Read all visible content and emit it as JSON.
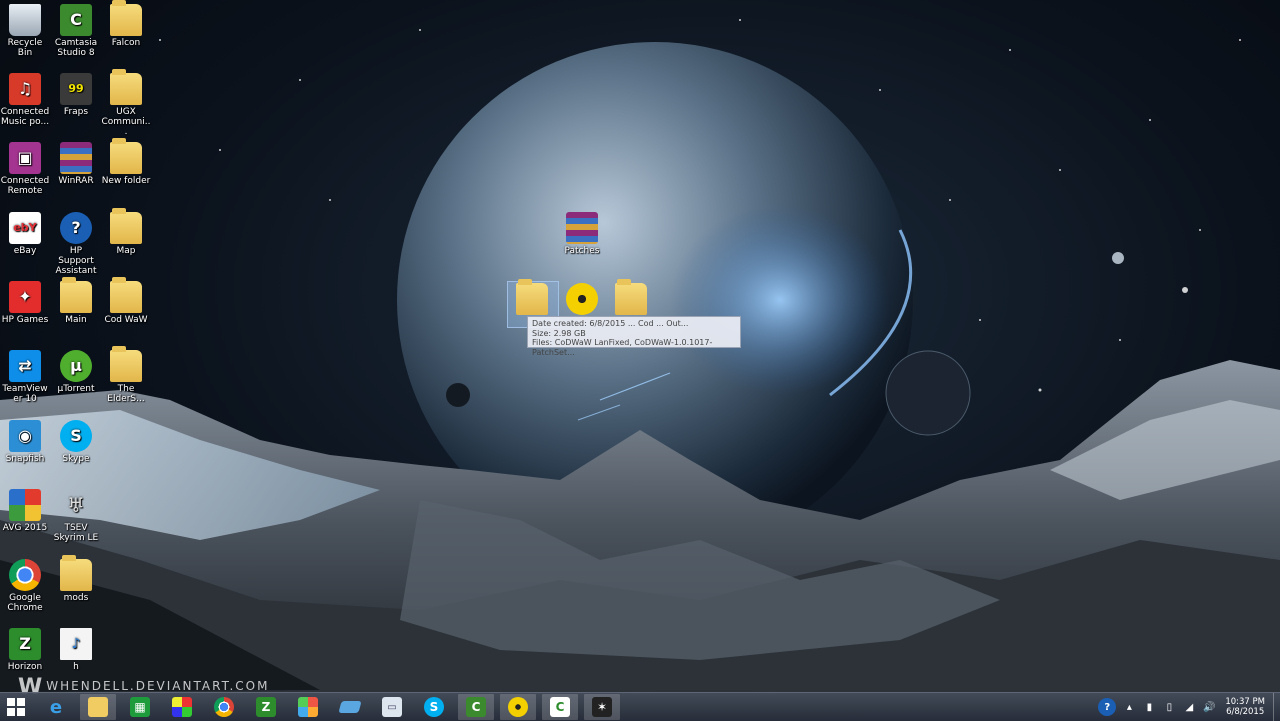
{
  "desktop": {
    "icons": [
      {
        "label": "Recycle Bin",
        "icon": "recycle-bin-icon"
      },
      {
        "label": "Camtasia Studio 8",
        "icon": "camtasia-icon"
      },
      {
        "label": "Falcon",
        "icon": "folder-icon"
      },
      {
        "label": "Connected Music po...",
        "icon": "connected-music-icon"
      },
      {
        "label": "Fraps",
        "icon": "fraps-icon"
      },
      {
        "label": "UGX Communi...",
        "icon": "folder-icon"
      },
      {
        "label": "Connected Remote",
        "icon": "connected-remote-icon"
      },
      {
        "label": "WinRAR",
        "icon": "winrar-icon"
      },
      {
        "label": "New folder",
        "icon": "folder-icon"
      },
      {
        "label": "eBay",
        "icon": "ebay-icon"
      },
      {
        "label": "HP Support Assistant",
        "icon": "hp-support-icon"
      },
      {
        "label": "Map",
        "icon": "folder-icon"
      },
      {
        "label": "HP Games",
        "icon": "hp-games-icon"
      },
      {
        "label": "Main",
        "icon": "folder-icon"
      },
      {
        "label": "Cod WaW",
        "icon": "folder-icon"
      },
      {
        "label": "TeamViewer 10",
        "icon": "teamviewer-icon"
      },
      {
        "label": "µTorrent",
        "icon": "utorrent-icon"
      },
      {
        "label": "The ElderS...",
        "icon": "folder-icon"
      },
      {
        "label": "Snapfish",
        "icon": "snapfish-icon"
      },
      {
        "label": "Skype",
        "icon": "skype-icon"
      },
      {
        "label": "AVG 2015",
        "icon": "avg-icon"
      },
      {
        "label": "TSEV Skyrim LE",
        "icon": "skyrim-icon"
      },
      {
        "label": "Google Chrome",
        "icon": "chrome-icon"
      },
      {
        "label": "mods",
        "icon": "folder-icon"
      },
      {
        "label": "Horizon",
        "icon": "horizon-icon"
      },
      {
        "label": "h",
        "icon": "audio-file-icon"
      },
      {
        "label": "Patches",
        "icon": "winrar-archive-icon"
      },
      {
        "label": "Patches",
        "icon": "folder-icon"
      }
    ],
    "tooltip": {
      "line1": "Date created: 6/8/2015 ... Cod ... Out...",
      "line2": "Size: 2.98 GB",
      "line3": "Files: CoDWaW LanFixed, CoDWaW-1.0.1017-PatchSet..."
    },
    "watermark": "WHENDELL.DEVIANTART.COM"
  },
  "taskbar": {
    "apps": [
      "start-icon",
      "ie-icon",
      "file-explorer-icon",
      "spreadsheet-icon",
      "color-app-icon",
      "chrome-icon",
      "horizon-icon",
      "puzzle-icon",
      "keyboard-icon",
      "monitor-icon",
      "skype-icon",
      "camtasia-icon",
      "disc-icon",
      "camtasia-recorder-icon",
      "game-icon"
    ],
    "tray": {
      "help": "?",
      "time": "10:37 PM",
      "date": "6/8/2015"
    }
  },
  "colors": {
    "taskbar": "#3a4150",
    "folder": "#f0cc62",
    "tooltip_bg": "#ebeef5"
  }
}
